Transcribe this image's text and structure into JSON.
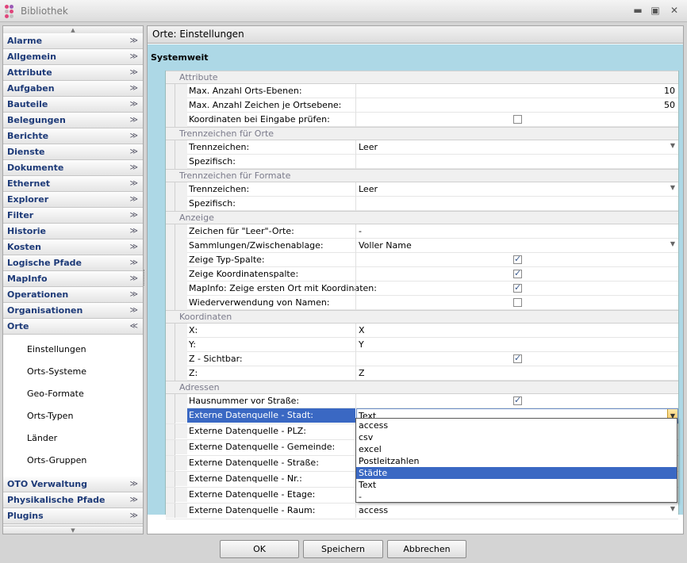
{
  "window": {
    "title": "Bibliothek"
  },
  "sidebar": {
    "items_top": [
      "Alarme",
      "Allgemein",
      "Attribute",
      "Aufgaben",
      "Bauteile",
      "Belegungen",
      "Berichte",
      "Dienste",
      "Dokumente",
      "Ethernet",
      "Explorer",
      "Filter",
      "Historie",
      "Kosten",
      "Logische Pfade",
      "MapInfo",
      "Operationen",
      "Organisationen",
      "Orte"
    ],
    "sub_items": [
      "Einstellungen",
      "Orts-Systeme",
      "Geo-Formate",
      "Orts-Typen",
      "Länder",
      "Orts-Gruppen"
    ],
    "items_bottom": [
      "OTO Verwaltung",
      "Physikalische Pfade",
      "Plugins"
    ]
  },
  "main": {
    "header": "Orte: Einstellungen",
    "section": "Systemweit"
  },
  "grid": {
    "categories": {
      "attribute": "Attribute",
      "trenn_orte": "Trennzeichen für Orte",
      "trenn_formate": "Trennzeichen für Formate",
      "anzeige": "Anzeige",
      "koordinaten": "Koordinaten",
      "adressen": "Adressen"
    },
    "rows": {
      "max_ebenen": {
        "label": "Max. Anzahl Orts-Ebenen:",
        "value": "10"
      },
      "max_zeichen": {
        "label": "Max. Anzahl Zeichen je Ortsebene:",
        "value": "50"
      },
      "koord_pruefen": {
        "label": "Koordinaten bei Eingabe prüfen:",
        "checked": false
      },
      "trenn1": {
        "label": "Trennzeichen:",
        "value": "Leer"
      },
      "spez1": {
        "label": "Spezifisch:",
        "value": ""
      },
      "trenn2": {
        "label": "Trennzeichen:",
        "value": "Leer"
      },
      "spez2": {
        "label": "Spezifisch:",
        "value": ""
      },
      "leer_orte": {
        "label": "Zeichen für \"Leer\"-Orte:",
        "value": "-"
      },
      "sammlungen": {
        "label": "Sammlungen/Zwischenablage:",
        "value": "Voller Name"
      },
      "typ_spalte": {
        "label": "Zeige Typ-Spalte:",
        "checked": true
      },
      "koord_spalte": {
        "label": "Zeige Koordinatenspalte:",
        "checked": true
      },
      "mapinfo": {
        "label": "MapInfo: Zeige ersten Ort mit Koordinaten:",
        "checked": true
      },
      "wiederverwendung": {
        "label": "Wiederverwendung von Namen:",
        "checked": false
      },
      "x": {
        "label": "X:",
        "value": "X"
      },
      "y": {
        "label": "Y:",
        "value": "Y"
      },
      "z_sichtbar": {
        "label": "Z - Sichtbar:",
        "checked": true
      },
      "z": {
        "label": "Z:",
        "value": "Z"
      },
      "hausnummer": {
        "label": "Hausnummer vor Straße:",
        "checked": true
      },
      "ext_stadt": {
        "label": "Externe Datenquelle - Stadt:",
        "value": "Text"
      },
      "ext_plz": {
        "label": "Externe Datenquelle - PLZ:"
      },
      "ext_gemeinde": {
        "label": "Externe Datenquelle - Gemeinde:"
      },
      "ext_strasse": {
        "label": "Externe Datenquelle - Straße:"
      },
      "ext_nr": {
        "label": "Externe Datenquelle - Nr.:"
      },
      "ext_etage": {
        "label": "Externe Datenquelle - Etage:"
      },
      "ext_raum": {
        "label": "Externe Datenquelle - Raum:",
        "value": "access"
      }
    }
  },
  "dropdown": {
    "options": [
      "access",
      "csv",
      "excel",
      "Postleitzahlen",
      "Städte",
      "Text",
      "-"
    ],
    "highlighted": "Städte"
  },
  "buttons": {
    "ok": "OK",
    "save": "Speichern",
    "cancel": "Abbrechen"
  },
  "colors": {
    "accent_blue": "#3a68c3",
    "panel_blue": "#add8e6",
    "sidebar_text": "#1d3a78"
  }
}
